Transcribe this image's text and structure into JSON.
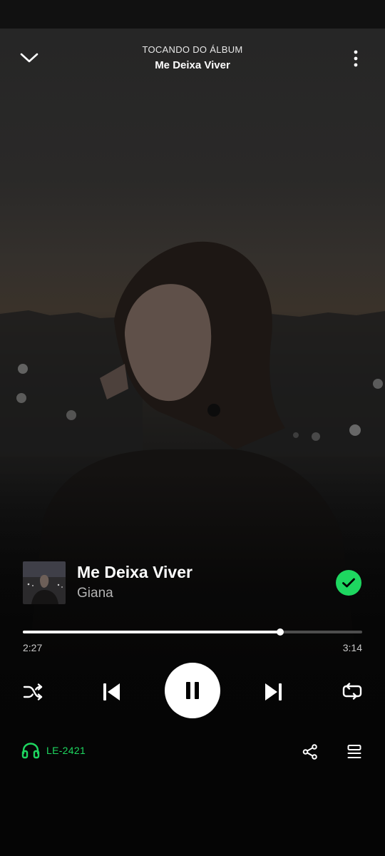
{
  "header": {
    "context_label": "TOCANDO DO ÁLBUM",
    "context_name": "Me Deixa Viver",
    "collapse_icon": "chevron-down-icon",
    "menu_icon": "more-vertical-icon"
  },
  "track": {
    "title": "Me Deixa Viver",
    "artist": "Giana",
    "liked": true,
    "liked_icon": "check-icon"
  },
  "playback": {
    "elapsed": "2:27",
    "duration": "3:14",
    "progress_fraction": 0.758,
    "state": "playing",
    "controls": [
      "shuffle-icon",
      "previous-icon",
      "pause-icon",
      "next-icon",
      "repeat-icon"
    ]
  },
  "footer": {
    "device_icon": "headphones-icon",
    "device_name": "LE-2421",
    "share_icon": "share-icon",
    "queue_icon": "queue-icon"
  },
  "colors": {
    "accent": "#1ed760",
    "background": "#050505",
    "progress_track": "#4d4d4d",
    "secondary_text": "#b3b3b3"
  }
}
